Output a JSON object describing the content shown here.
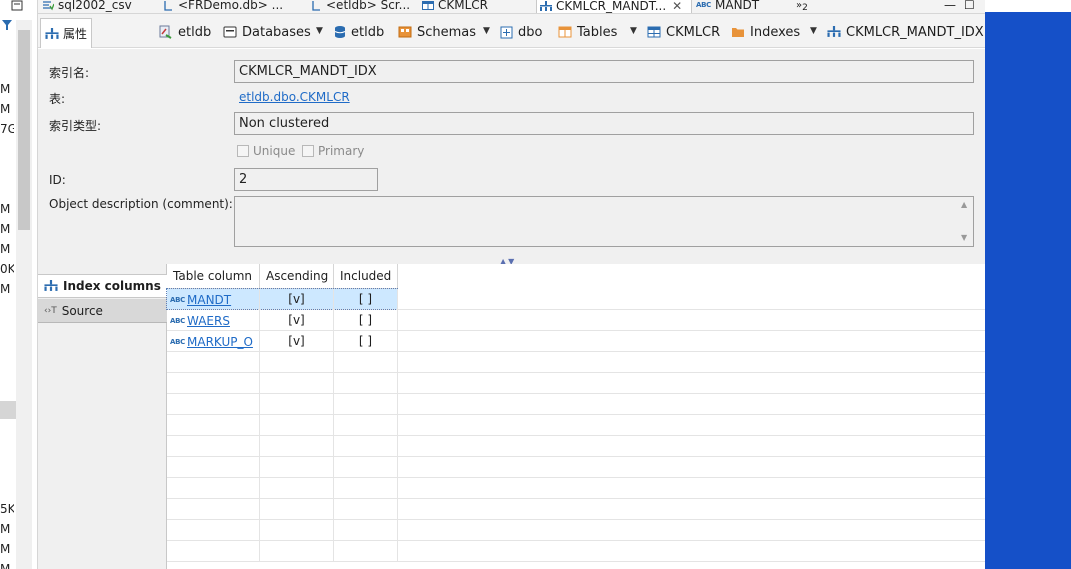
{
  "left_strip": {
    "rows": [
      "M",
      "M",
      "7G",
      "M",
      "M",
      "M",
      "0K",
      "M",
      "5K",
      "M",
      "M",
      "M"
    ]
  },
  "editor_tabs": [
    {
      "label": "sql2002_csv",
      "active": false
    },
    {
      "label": "<FRDemo.db> ...",
      "active": false
    },
    {
      "label": "<etldb> Scr...",
      "active": false
    },
    {
      "label": "CKMLCR",
      "active": false
    },
    {
      "label": "CKMLCR_MANDT...",
      "active": true
    },
    {
      "label": "MANDT",
      "active": false
    },
    {
      "label": "2",
      "active": false
    }
  ],
  "toolbar": {
    "attr_tab": "属性",
    "breadcrumbs": [
      "etldb",
      "Databases",
      "etldb",
      "Schemas",
      "dbo",
      "Tables",
      "CKMLCR",
      "Indexes",
      "CKMLCR_MANDT_IDX"
    ]
  },
  "props": {
    "index_name_label": "索引名:",
    "index_name_value": "CKMLCR_MANDT_IDX",
    "table_label": "表:",
    "table_value": "etldb.dbo.CKMLCR",
    "index_type_label": "索引类型:",
    "index_type_value": "Non clustered",
    "unique_label": "Unique",
    "primary_label": "Primary",
    "id_label": "ID:",
    "id_value": "2",
    "description_label": "Object description (comment):",
    "description_value": ""
  },
  "side_tabs": {
    "index_columns": "Index columns",
    "source": "Source"
  },
  "grid": {
    "headers": [
      "Table column",
      "Ascending",
      "Included"
    ],
    "rows": [
      {
        "column": "MANDT",
        "ascending": "[v]",
        "included": "[ ]",
        "selected": true
      },
      {
        "column": "WAERS",
        "ascending": "[v]",
        "included": "[ ]",
        "selected": false
      },
      {
        "column": "MARKUP_O",
        "ascending": "[v]",
        "included": "[ ]",
        "selected": false
      }
    ]
  },
  "colors": {
    "desktop_blue": "#1550c8",
    "link_blue": "#1f6bc7",
    "selection": "#cde8ff"
  }
}
